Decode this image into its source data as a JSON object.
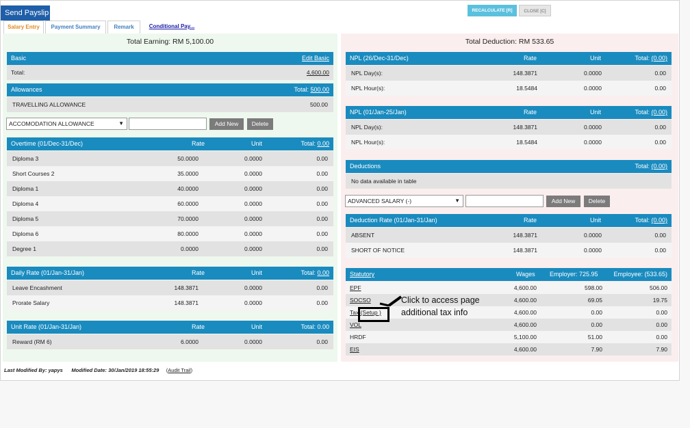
{
  "header": {
    "title": "Send Payslip",
    "recalculate": "RECALCULATE [R]",
    "close": "CLOSE [C]"
  },
  "tabs": [
    "Salary Entry",
    "Payment Summary",
    "Remark",
    "Conditional Pay..."
  ],
  "left": {
    "total_earning": "Total Earning: RM 5,100.00",
    "basic": {
      "title": "Basic",
      "edit": "Edit Basic",
      "total_label": "Total:",
      "total_value": "4,600.00"
    },
    "allowances": {
      "title": "Allowances",
      "total_label": "Total:",
      "total_value": "500.00",
      "rows": [
        {
          "name": "TRAVELLING ALLOWANCE",
          "value": "500.00"
        }
      ],
      "select": "ACCOMODATION ALLOWANCE",
      "add": "Add New",
      "delete": "Delete"
    },
    "overtime": {
      "title": "Overtime (01/Dec-31/Dec)",
      "col_rate": "Rate",
      "col_unit": "Unit",
      "total_label": "Total:",
      "total_value": "0.00",
      "rows": [
        {
          "name": "Diploma 3",
          "rate": "50.0000",
          "unit": "0.0000",
          "total": "0.00"
        },
        {
          "name": "Short Courses 2",
          "rate": "35.0000",
          "unit": "0.0000",
          "total": "0.00"
        },
        {
          "name": "Diploma 1",
          "rate": "40.0000",
          "unit": "0.0000",
          "total": "0.00"
        },
        {
          "name": "Diploma 4",
          "rate": "60.0000",
          "unit": "0.0000",
          "total": "0.00"
        },
        {
          "name": "Diploma 5",
          "rate": "70.0000",
          "unit": "0.0000",
          "total": "0.00"
        },
        {
          "name": "Diploma 6",
          "rate": "80.0000",
          "unit": "0.0000",
          "total": "0.00"
        },
        {
          "name": "Degree 1",
          "rate": "0.0000",
          "unit": "0.0000",
          "total": "0.00"
        }
      ]
    },
    "daily": {
      "title": "Daily Rate (01/Jan-31/Jan)",
      "col_rate": "Rate",
      "col_unit": "Unit",
      "total_label": "Total:",
      "total_value": "0.00",
      "rows": [
        {
          "name": "Leave Encashment",
          "rate": "148.3871",
          "unit": "0.0000",
          "total": "0.00"
        },
        {
          "name": "Prorate Salary",
          "rate": "148.3871",
          "unit": "0.0000",
          "total": "0.00"
        }
      ]
    },
    "unit": {
      "title": "Unit Rate (01/Jan-31/Jan)",
      "col_rate": "Rate",
      "col_unit": "Unit",
      "total_label": "Total: 0.00",
      "rows": [
        {
          "name": "Reward (RM 6)",
          "rate": "6.0000",
          "unit": "0.0000",
          "total": "0.00"
        }
      ]
    }
  },
  "right": {
    "total_deduction": "Total Deduction: RM 533.65",
    "npl1": {
      "title": "NPL (26/Dec-31/Dec)",
      "col_rate": "Rate",
      "col_unit": "Unit",
      "total_label": "Total:",
      "total_value": "(0.00)",
      "rows": [
        {
          "name": "NPL Day(s):",
          "rate": "148.3871",
          "unit": "0.0000",
          "total": "0.00"
        },
        {
          "name": "NPL Hour(s):",
          "rate": "18.5484",
          "unit": "0.0000",
          "total": "0.00"
        }
      ]
    },
    "npl2": {
      "title": "NPL (01/Jan-25/Jan)",
      "col_rate": "Rate",
      "col_unit": "Unit",
      "total_label": "Total:",
      "total_value": "(0.00)",
      "rows": [
        {
          "name": "NPL Day(s):",
          "rate": "148.3871",
          "unit": "0.0000",
          "total": "0.00"
        },
        {
          "name": "NPL Hour(s):",
          "rate": "18.5484",
          "unit": "0.0000",
          "total": "0.00"
        }
      ]
    },
    "deductions": {
      "title": "Deductions",
      "total_label": "Total:",
      "total_value": "(0.00)",
      "empty": "No data available in table",
      "select": "ADVANCED SALARY (-)",
      "add": "Add New",
      "delete": "Delete"
    },
    "deduction_rate": {
      "title": "Deduction Rate (01/Jan-31/Jan)",
      "col_rate": "Rate",
      "col_unit": "Unit",
      "total_label": "Total:",
      "total_value": "(0.00)",
      "rows": [
        {
          "name": "ABSENT",
          "rate": "148.3871",
          "unit": "0.0000",
          "total": "0.00"
        },
        {
          "name": "SHORT OF NOTICE",
          "rate": "148.3871",
          "unit": "0.0000",
          "total": "0.00"
        }
      ]
    },
    "statutory": {
      "title": "Statutory",
      "col_wages": "Wages",
      "col_employer": "Employer: 725.95",
      "col_employee": "Employee: (533.65)",
      "rows": [
        {
          "name": "EPF",
          "wages": "4,600.00",
          "employer": "598.00",
          "employee": "506.00"
        },
        {
          "name": "SOCSO",
          "wages": "4,600.00",
          "employer": "69.05",
          "employee": "19.75"
        },
        {
          "name": "Tax (Setup )",
          "wages": "4,600.00",
          "employer": "0.00",
          "employee": "0.00"
        },
        {
          "name": "VOL",
          "wages": "4,600.00",
          "employer": "0.00",
          "employee": "0.00"
        },
        {
          "name": "HRDF",
          "wages": "5,100.00",
          "employer": "51.00",
          "employee": "0.00"
        },
        {
          "name": "EIS",
          "wages": "4,600.00",
          "employer": "7.90",
          "employee": "7.90"
        }
      ]
    }
  },
  "callout": {
    "line1": "Click to access page",
    "line2": "additional tax info"
  },
  "footer": {
    "modified_by": "Last Modified By: yapys",
    "modified_date": "Modified Date: 30/Jan/2019 18:55:29",
    "audit": "Audit Trail"
  }
}
